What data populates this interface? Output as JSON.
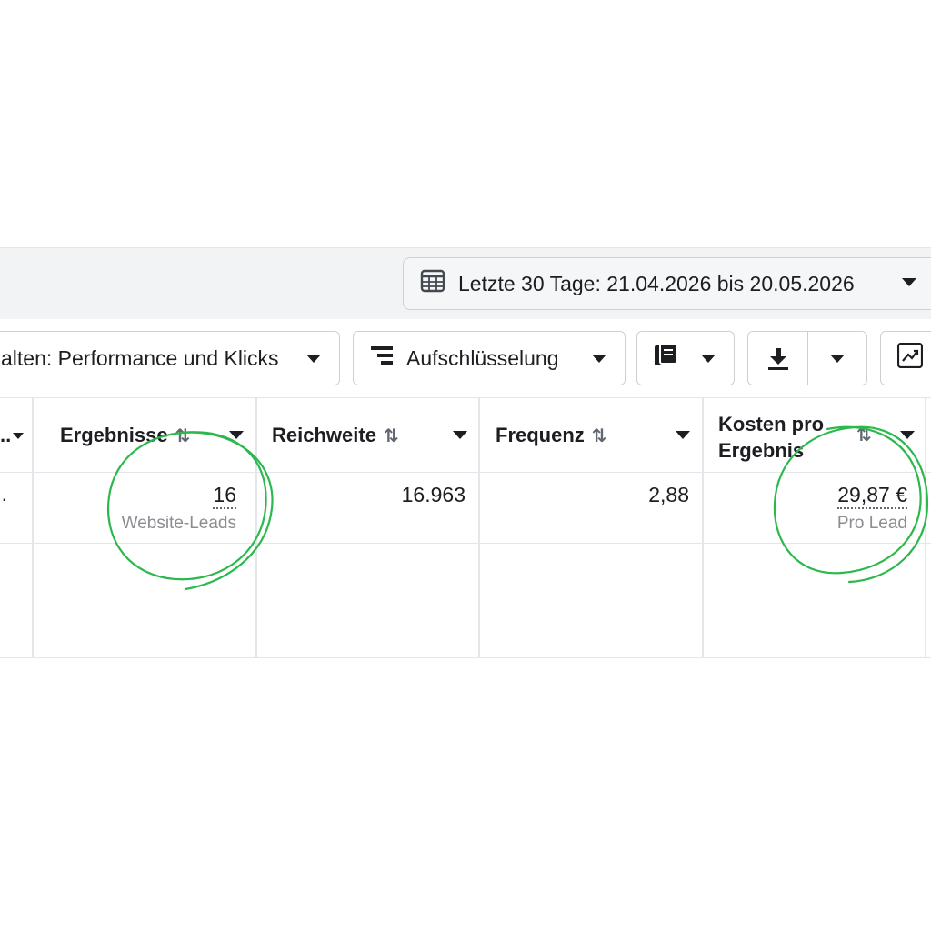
{
  "toolbar": {
    "date_range_label": "Letzte 30 Tage: 21.04.2026 bis 20.05.2026",
    "columns_label": "alten: Performance und Klicks",
    "breakdown_label": "Aufschlüsselung"
  },
  "table": {
    "headers": {
      "first_truncated": "..",
      "results": "Ergebnisse",
      "reach": "Reichweite",
      "frequency": "Frequenz",
      "cost_line1": "Kosten pro",
      "cost_line2": "Ergebnis"
    },
    "row": {
      "first_truncated": ".",
      "results": "16",
      "results_sub": "Website-Leads",
      "reach": "16.963",
      "frequency": "2,88",
      "cost": "29,87 €",
      "cost_sub": "Pro Lead"
    }
  },
  "icons": [
    "calendar-icon",
    "breakdown-icon",
    "reports-icon",
    "download-icon",
    "chart-icon",
    "sort-icon",
    "caret-down-icon"
  ],
  "colors": {
    "highlight_circle": "#2db84e",
    "toolbar_bg": "#f2f3f5",
    "text": "#1c1e21",
    "subtext": "#8a8d91"
  }
}
